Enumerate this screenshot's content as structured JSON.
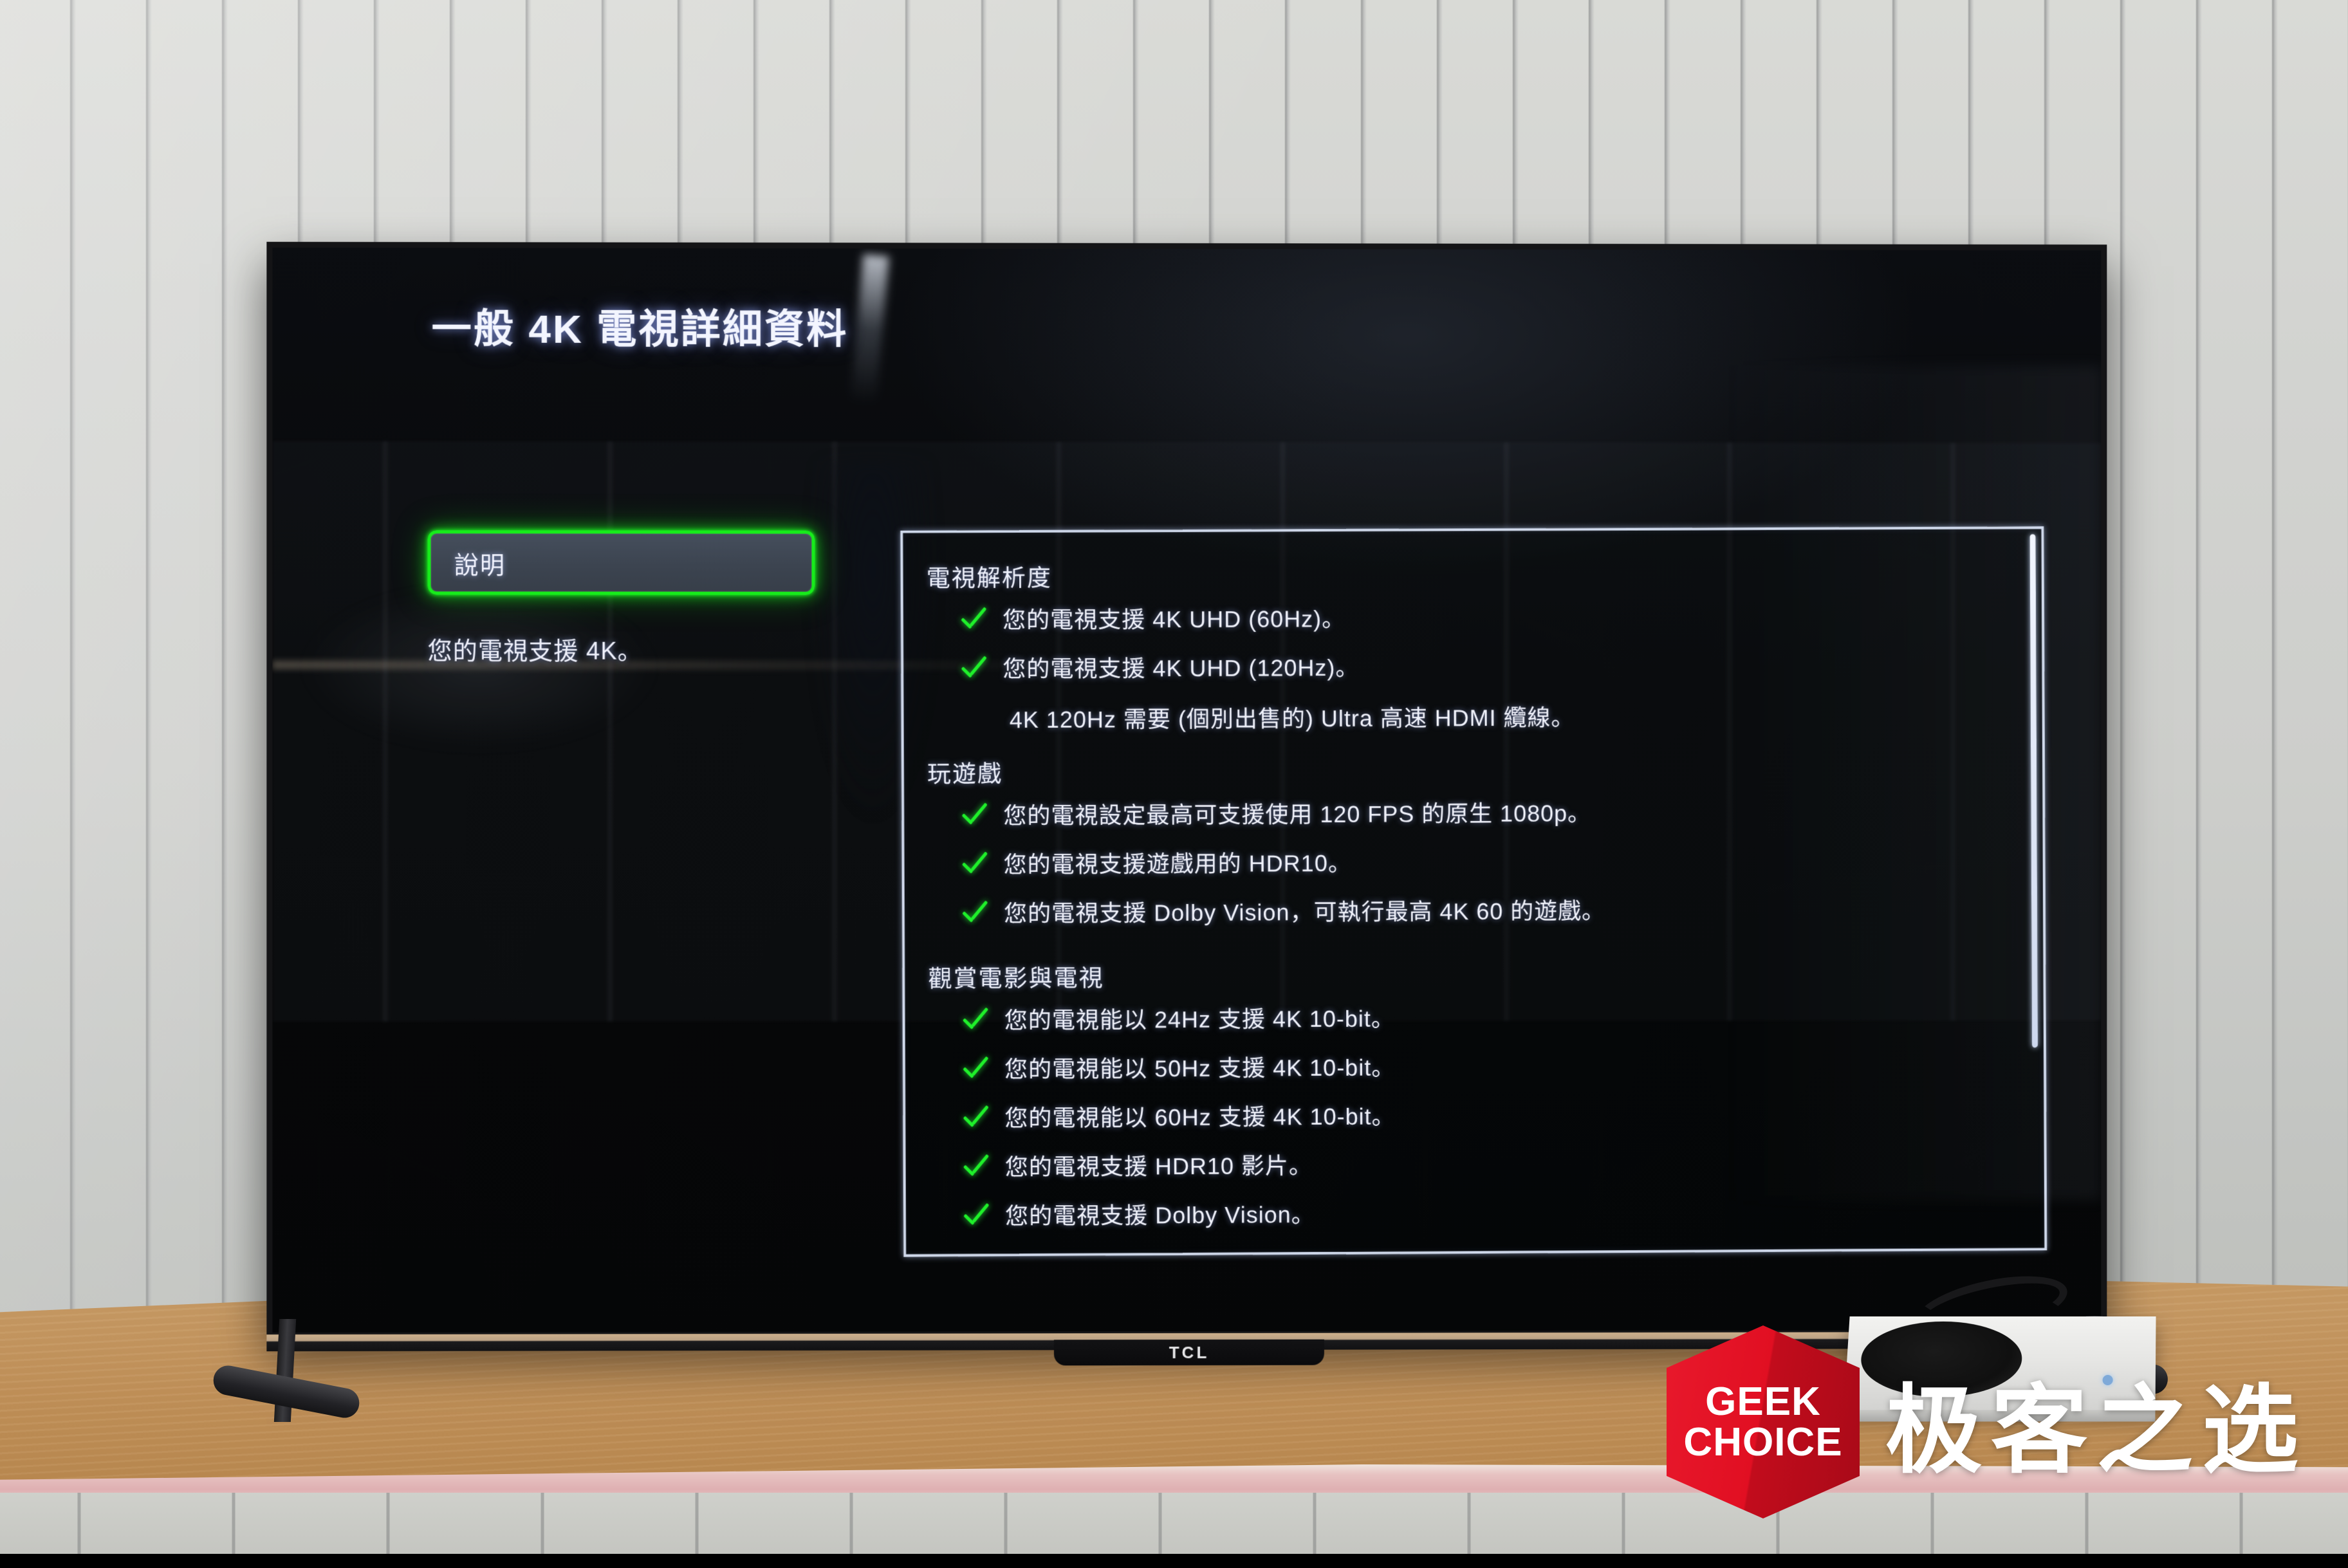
{
  "screen": {
    "title": "一般 4K 電視詳細資料",
    "sidebar": {
      "help_button_label": "說明",
      "note": "您的電視支援 4K。"
    },
    "panel": {
      "sections": [
        {
          "heading": "電視解析度",
          "items": [
            "您的電視支援 4K UHD (60Hz)。",
            "您的電視支援 4K UHD (120Hz)。"
          ],
          "sub_note": "4K 120Hz 需要 (個別出售的) Ultra 高速 HDMI 纜線。"
        },
        {
          "heading": "玩遊戲",
          "items": [
            "您的電視設定最高可支援使用 120 FPS 的原生 1080p。",
            "您的電視支援遊戲用的 HDR10。",
            "您的電視支援 Dolby Vision，可執行最高 4K 60 的遊戲。"
          ],
          "sub_note": ""
        },
        {
          "heading": "觀賞電影與電視",
          "items": [
            "您的電視能以 24Hz 支援 4K 10-bit。",
            "您的電視能以 50Hz 支援 4K 10-bit。",
            "您的電視能以 60Hz 支援 4K 10-bit。",
            "您的電視支援 HDR10 影片。",
            "您的電視支援 Dolby Vision。"
          ],
          "sub_note": ""
        }
      ]
    }
  },
  "device": {
    "tv_brand": "TCL"
  },
  "watermark": {
    "badge_line1": "GEEK",
    "badge_line2": "CHOICE",
    "chinese": "极客之选",
    "badge_color": "#e1192b"
  },
  "colors": {
    "focus_green": "#1cff20",
    "check_green": "#1ff02a",
    "panel_border": "#e2ebff",
    "text": "#f1f3fc",
    "button_fill": "#3e4650"
  }
}
